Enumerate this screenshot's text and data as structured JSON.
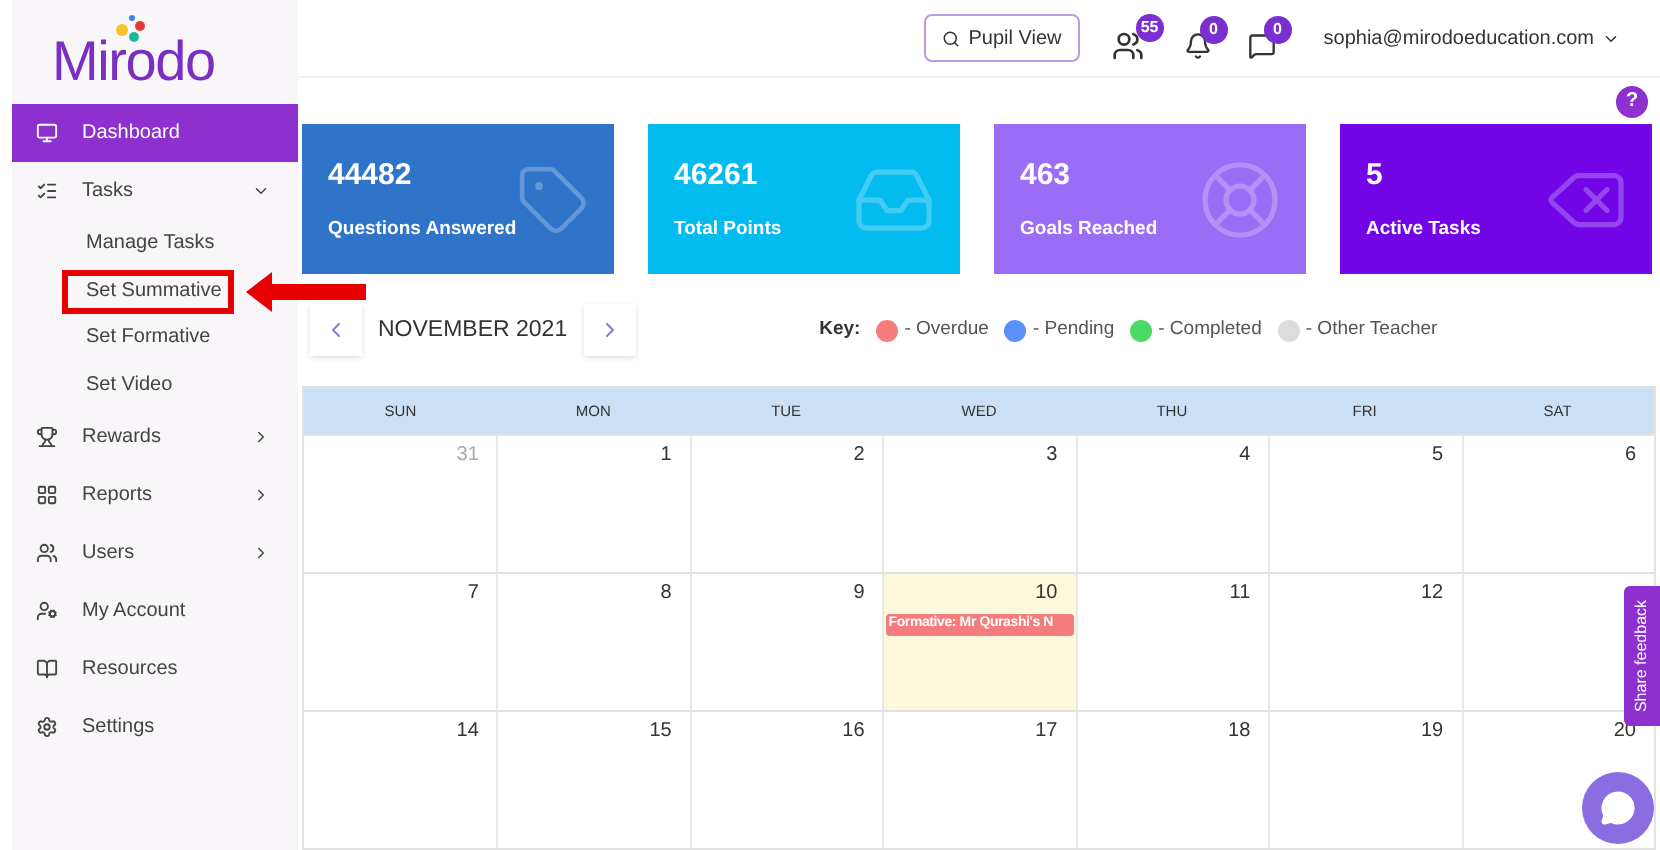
{
  "logo": {
    "text": "Mirodo"
  },
  "sidebar": {
    "items": [
      {
        "label": "Dashboard",
        "selected": true
      },
      {
        "label": "Tasks",
        "selected": false,
        "expanded": true,
        "children": [
          {
            "label": "Manage Tasks",
            "highlighted": false
          },
          {
            "label": "Set Summative",
            "highlighted": true
          },
          {
            "label": "Set Formative",
            "highlighted": false
          },
          {
            "label": "Set Video",
            "highlighted": false
          }
        ]
      },
      {
        "label": "Rewards",
        "selected": false,
        "expanded": false
      },
      {
        "label": "Reports",
        "selected": false,
        "expanded": false
      },
      {
        "label": "Users",
        "selected": false,
        "expanded": false
      },
      {
        "label": "My Account",
        "selected": false
      },
      {
        "label": "Resources",
        "selected": false
      },
      {
        "label": "Settings",
        "selected": false
      }
    ]
  },
  "header": {
    "pupil_view": "Pupil View",
    "pupils_badge": "55",
    "notifications_badge": "0",
    "messages_badge": "0",
    "user_email": "sophia@mirodoeducation.com",
    "help": "?"
  },
  "stats": [
    {
      "value": "44482",
      "label": "Questions Answered",
      "color": "#3074c9"
    },
    {
      "value": "46261",
      "label": "Total Points",
      "color": "#02bbef"
    },
    {
      "value": "463",
      "label": "Goals Reached",
      "color": "#9b6cf5"
    },
    {
      "value": "5",
      "label": "Active Tasks",
      "color": "#7206e6"
    }
  ],
  "calendar": {
    "month": "NOVEMBER 2021",
    "key_label": "Key:",
    "key": [
      {
        "label": "- Overdue",
        "color": "#f47c7c"
      },
      {
        "label": "- Pending",
        "color": "#5b8ff9"
      },
      {
        "label": "- Completed",
        "color": "#4cd964"
      },
      {
        "label": "- Other Teacher",
        "color": "#dcdcdc"
      }
    ],
    "weekdays": [
      "SUN",
      "MON",
      "TUE",
      "WED",
      "THU",
      "FRI",
      "SAT"
    ],
    "weeks": [
      [
        {
          "day": "31",
          "muted": true
        },
        {
          "day": "1"
        },
        {
          "day": "2"
        },
        {
          "day": "3"
        },
        {
          "day": "4"
        },
        {
          "day": "5"
        },
        {
          "day": "6"
        }
      ],
      [
        {
          "day": "7"
        },
        {
          "day": "8"
        },
        {
          "day": "9"
        },
        {
          "day": "10",
          "today": true,
          "events": [
            {
              "label": "Formative: Mr Qurashi's N",
              "color": "#f47c7c"
            }
          ]
        },
        {
          "day": "11"
        },
        {
          "day": "12"
        }
      ],
      [
        {
          "day": "14"
        },
        {
          "day": "15"
        },
        {
          "day": "16"
        },
        {
          "day": "17"
        },
        {
          "day": "18"
        },
        {
          "day": "19"
        },
        {
          "day": "20"
        }
      ]
    ]
  },
  "feedback_tab": "Share feedback"
}
